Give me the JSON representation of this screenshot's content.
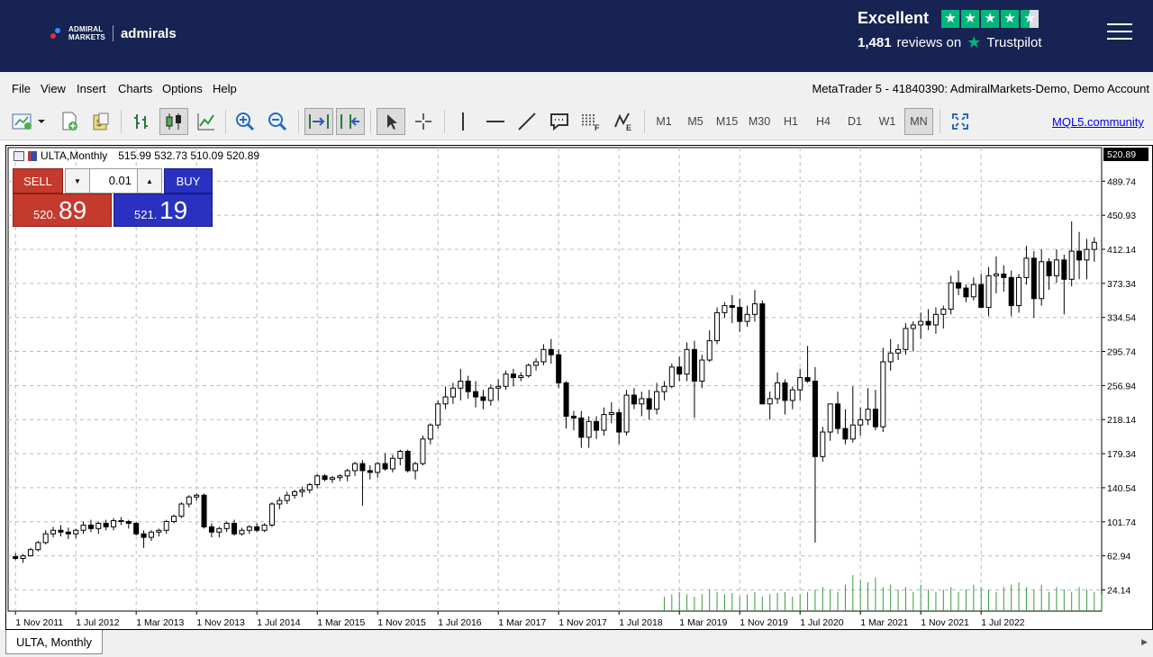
{
  "brand": {
    "small_text_line1": "ADMIRAL",
    "small_text_line2": "MARKETS",
    "name": "admirals"
  },
  "trustpilot": {
    "rating_word": "Excellent",
    "reviews_count": "1,481",
    "reviews_on": "reviews on",
    "platform": "Trustpilot",
    "stars": 4.5
  },
  "menu": {
    "items": [
      "File",
      "View",
      "Insert",
      "Charts",
      "Options",
      "Help"
    ],
    "account_info": "MetaTrader 5 - 41840390: AdmiralMarkets-Demo, Demo Account"
  },
  "toolbar": {
    "timeframes": [
      "M1",
      "M5",
      "M15",
      "M30",
      "H1",
      "H4",
      "D1",
      "W1",
      "MN"
    ],
    "active_timeframe": "MN",
    "community_link": "MQL5.community",
    "icons": [
      "new-chart-icon",
      "new-order-icon",
      "market-watch-icon",
      "bar-chart-icon",
      "candlestick-icon",
      "line-chart-icon",
      "zoom-in-icon",
      "zoom-out-icon",
      "auto-scroll-icon",
      "chart-shift-icon",
      "cursor-icon",
      "crosshair-icon",
      "vertical-line-icon",
      "horizontal-line-icon",
      "trendline-icon",
      "text-label-icon",
      "fibonacci-icon",
      "elliott-wave-icon",
      "fullscreen-icon"
    ]
  },
  "chart": {
    "symbol_period": "ULTA,Monthly",
    "ohlc": "515.99 532.73 510.09 520.89",
    "current_price_label": "520.89"
  },
  "trade_panel": {
    "sell_label": "SELL",
    "buy_label": "BUY",
    "volume": "0.01",
    "sell_price_small": "520.",
    "sell_price_big": "89",
    "buy_price_small": "521.",
    "buy_price_big": "19"
  },
  "tabs": {
    "active": "ULTA, Monthly"
  },
  "chart_data": {
    "type": "candlestick",
    "y_ticks": [
      "489.74",
      "450.93",
      "412.14",
      "373.34",
      "334.54",
      "295.74",
      "256.94",
      "218.14",
      "179.34",
      "140.54",
      "101.74",
      "62.94",
      "24.14"
    ],
    "x_ticks": [
      "1 Nov 2011",
      "1 Jul 2012",
      "1 Mar 2013",
      "1 Nov 2013",
      "1 Jul 2014",
      "1 Mar 2015",
      "1 Nov 2015",
      "1 Jul 2016",
      "1 Mar 2017",
      "1 Nov 2017",
      "1 Jul 2018",
      "1 Mar 2019",
      "1 Nov 2019",
      "1 Jul 2020",
      "1 Mar 2021",
      "1 Nov 2021",
      "1 Jul 2022"
    ],
    "ylim": [
      0,
      528
    ],
    "start": "2011-11",
    "grid": true,
    "ohlc": [
      [
        62,
        66,
        58,
        60
      ],
      [
        60,
        65,
        55,
        63
      ],
      [
        63,
        72,
        62,
        70
      ],
      [
        70,
        80,
        68,
        78
      ],
      [
        78,
        92,
        76,
        88
      ],
      [
        88,
        96,
        84,
        92
      ],
      [
        92,
        98,
        85,
        90
      ],
      [
        90,
        95,
        82,
        88
      ],
      [
        88,
        94,
        83,
        92
      ],
      [
        92,
        102,
        88,
        98
      ],
      [
        98,
        104,
        90,
        94
      ],
      [
        94,
        102,
        88,
        100
      ],
      [
        100,
        104,
        92,
        96
      ],
      [
        96,
        106,
        92,
        103
      ],
      [
        103,
        107,
        98,
        102
      ],
      [
        102,
        104,
        94,
        100
      ],
      [
        100,
        102,
        86,
        88
      ],
      [
        88,
        92,
        72,
        84
      ],
      [
        84,
        92,
        80,
        90
      ],
      [
        90,
        94,
        85,
        92
      ],
      [
        92,
        104,
        88,
        102
      ],
      [
        102,
        110,
        100,
        108
      ],
      [
        108,
        124,
        106,
        122
      ],
      [
        122,
        132,
        118,
        130
      ],
      [
        130,
        134,
        126,
        132
      ],
      [
        132,
        134,
        94,
        96
      ],
      [
        96,
        100,
        84,
        90
      ],
      [
        90,
        96,
        84,
        94
      ],
      [
        94,
        102,
        90,
        100
      ],
      [
        100,
        104,
        86,
        88
      ],
      [
        88,
        95,
        86,
        92
      ],
      [
        92,
        98,
        88,
        96
      ],
      [
        96,
        100,
        90,
        92
      ],
      [
        92,
        100,
        90,
        98
      ],
      [
        98,
        124,
        96,
        122
      ],
      [
        122,
        130,
        116,
        126
      ],
      [
        126,
        136,
        122,
        132
      ],
      [
        132,
        138,
        128,
        136
      ],
      [
        136,
        142,
        130,
        138
      ],
      [
        138,
        146,
        134,
        144
      ],
      [
        144,
        156,
        140,
        154
      ],
      [
        154,
        156,
        148,
        150
      ],
      [
        150,
        154,
        146,
        152
      ],
      [
        152,
        156,
        148,
        154
      ],
      [
        154,
        162,
        148,
        160
      ],
      [
        160,
        170,
        154,
        168
      ],
      [
        168,
        172,
        120,
        160
      ],
      [
        160,
        166,
        150,
        158
      ],
      [
        158,
        170,
        152,
        168
      ],
      [
        168,
        180,
        160,
        162
      ],
      [
        162,
        178,
        158,
        174
      ],
      [
        174,
        184,
        166,
        182
      ],
      [
        182,
        184,
        158,
        160
      ],
      [
        160,
        170,
        150,
        168
      ],
      [
        168,
        200,
        166,
        196
      ],
      [
        196,
        214,
        190,
        212
      ],
      [
        212,
        240,
        208,
        236
      ],
      [
        236,
        256,
        230,
        244
      ],
      [
        244,
        260,
        236,
        254
      ],
      [
        254,
        276,
        240,
        262
      ],
      [
        262,
        268,
        242,
        250
      ],
      [
        250,
        262,
        232,
        244
      ],
      [
        244,
        252,
        230,
        240
      ],
      [
        240,
        258,
        234,
        254
      ],
      [
        254,
        264,
        240,
        256
      ],
      [
        256,
        274,
        252,
        270
      ],
      [
        270,
        276,
        256,
        266
      ],
      [
        266,
        272,
        262,
        268
      ],
      [
        268,
        282,
        266,
        280
      ],
      [
        280,
        288,
        274,
        284
      ],
      [
        284,
        304,
        280,
        298
      ],
      [
        298,
        310,
        282,
        292
      ],
      [
        292,
        298,
        254,
        260
      ],
      [
        260,
        262,
        208,
        222
      ],
      [
        222,
        228,
        206,
        220
      ],
      [
        220,
        228,
        186,
        198
      ],
      [
        198,
        222,
        186,
        216
      ],
      [
        216,
        222,
        196,
        206
      ],
      [
        206,
        232,
        200,
        224
      ],
      [
        224,
        238,
        214,
        226
      ],
      [
        226,
        230,
        190,
        204
      ],
      [
        204,
        252,
        200,
        246
      ],
      [
        246,
        254,
        230,
        236
      ],
      [
        236,
        250,
        222,
        242
      ],
      [
        242,
        252,
        218,
        230
      ],
      [
        230,
        260,
        224,
        250
      ],
      [
        250,
        262,
        240,
        256
      ],
      [
        256,
        282,
        254,
        278
      ],
      [
        278,
        290,
        262,
        270
      ],
      [
        270,
        306,
        262,
        298
      ],
      [
        298,
        308,
        220,
        262
      ],
      [
        262,
        292,
        254,
        286
      ],
      [
        286,
        320,
        284,
        308
      ],
      [
        308,
        346,
        304,
        340
      ],
      [
        340,
        352,
        334,
        348
      ],
      [
        348,
        360,
        328,
        346
      ],
      [
        346,
        356,
        318,
        330
      ],
      [
        330,
        348,
        324,
        338
      ],
      [
        338,
        366,
        330,
        350
      ],
      [
        350,
        354,
        236,
        236
      ],
      [
        236,
        250,
        218,
        242
      ],
      [
        242,
        272,
        236,
        260
      ],
      [
        260,
        264,
        224,
        240
      ],
      [
        240,
        256,
        230,
        252
      ],
      [
        252,
        276,
        240,
        266
      ],
      [
        266,
        302,
        260,
        262
      ],
      [
        262,
        278,
        78,
        176
      ],
      [
        176,
        210,
        170,
        204
      ],
      [
        204,
        230,
        194,
        236
      ],
      [
        236,
        250,
        202,
        208
      ],
      [
        208,
        230,
        190,
        196
      ],
      [
        196,
        256,
        192,
        212
      ],
      [
        212,
        232,
        200,
        218
      ],
      [
        218,
        254,
        212,
        230
      ],
      [
        230,
        252,
        206,
        210
      ],
      [
        210,
        300,
        204,
        284
      ],
      [
        284,
        310,
        274,
        294
      ],
      [
        294,
        304,
        286,
        298
      ],
      [
        298,
        328,
        292,
        322
      ],
      [
        322,
        330,
        296,
        326
      ],
      [
        326,
        340,
        310,
        330
      ],
      [
        330,
        344,
        320,
        326
      ],
      [
        326,
        346,
        316,
        338
      ],
      [
        338,
        348,
        322,
        344
      ],
      [
        344,
        382,
        338,
        374
      ],
      [
        374,
        388,
        360,
        368
      ],
      [
        368,
        372,
        352,
        358
      ],
      [
        358,
        380,
        354,
        372
      ],
      [
        372,
        384,
        346,
        346
      ],
      [
        346,
        392,
        336,
        382
      ],
      [
        382,
        404,
        362,
        384
      ],
      [
        384,
        394,
        364,
        380
      ],
      [
        380,
        388,
        336,
        348
      ],
      [
        348,
        384,
        340,
        380
      ],
      [
        380,
        416,
        372,
        402
      ],
      [
        402,
        410,
        334,
        356
      ],
      [
        356,
        412,
        348,
        398
      ],
      [
        398,
        402,
        366,
        382
      ],
      [
        382,
        412,
        374,
        400
      ],
      [
        400,
        406,
        338,
        378
      ],
      [
        378,
        444,
        370,
        410
      ],
      [
        410,
        432,
        378,
        400
      ],
      [
        400,
        424,
        378,
        412
      ],
      [
        412,
        426,
        398,
        420
      ]
    ],
    "volume": [
      0,
      0,
      0,
      0,
      0,
      0,
      0,
      0,
      0,
      0,
      0,
      0,
      0,
      0,
      0,
      0,
      0,
      0,
      0,
      0,
      0,
      0,
      0,
      0,
      0,
      0,
      0,
      0,
      0,
      0,
      0,
      0,
      0,
      0,
      0,
      0,
      0,
      0,
      0,
      0,
      0,
      0,
      0,
      0,
      0,
      0,
      0,
      0,
      0,
      0,
      0,
      0,
      0,
      0,
      0,
      0,
      0,
      0,
      0,
      0,
      0,
      0,
      0,
      0,
      0,
      0,
      0,
      0,
      0,
      0,
      0,
      0,
      0,
      0,
      0,
      0,
      0,
      0,
      0,
      0,
      0,
      0,
      0,
      0,
      0,
      0,
      12,
      14,
      16,
      14,
      12,
      14,
      18,
      16,
      14,
      15,
      12,
      14,
      16,
      12,
      14,
      15,
      16,
      12,
      14,
      16,
      18,
      20,
      18,
      16,
      22,
      30,
      26,
      24,
      28,
      20,
      22,
      18,
      20,
      16,
      22,
      18,
      16,
      18,
      20,
      16,
      18,
      22,
      20,
      18,
      16,
      20,
      22,
      24,
      20,
      18,
      22,
      16,
      20,
      18,
      16,
      20,
      18,
      16,
      14
    ],
    "volume_max": 30
  }
}
